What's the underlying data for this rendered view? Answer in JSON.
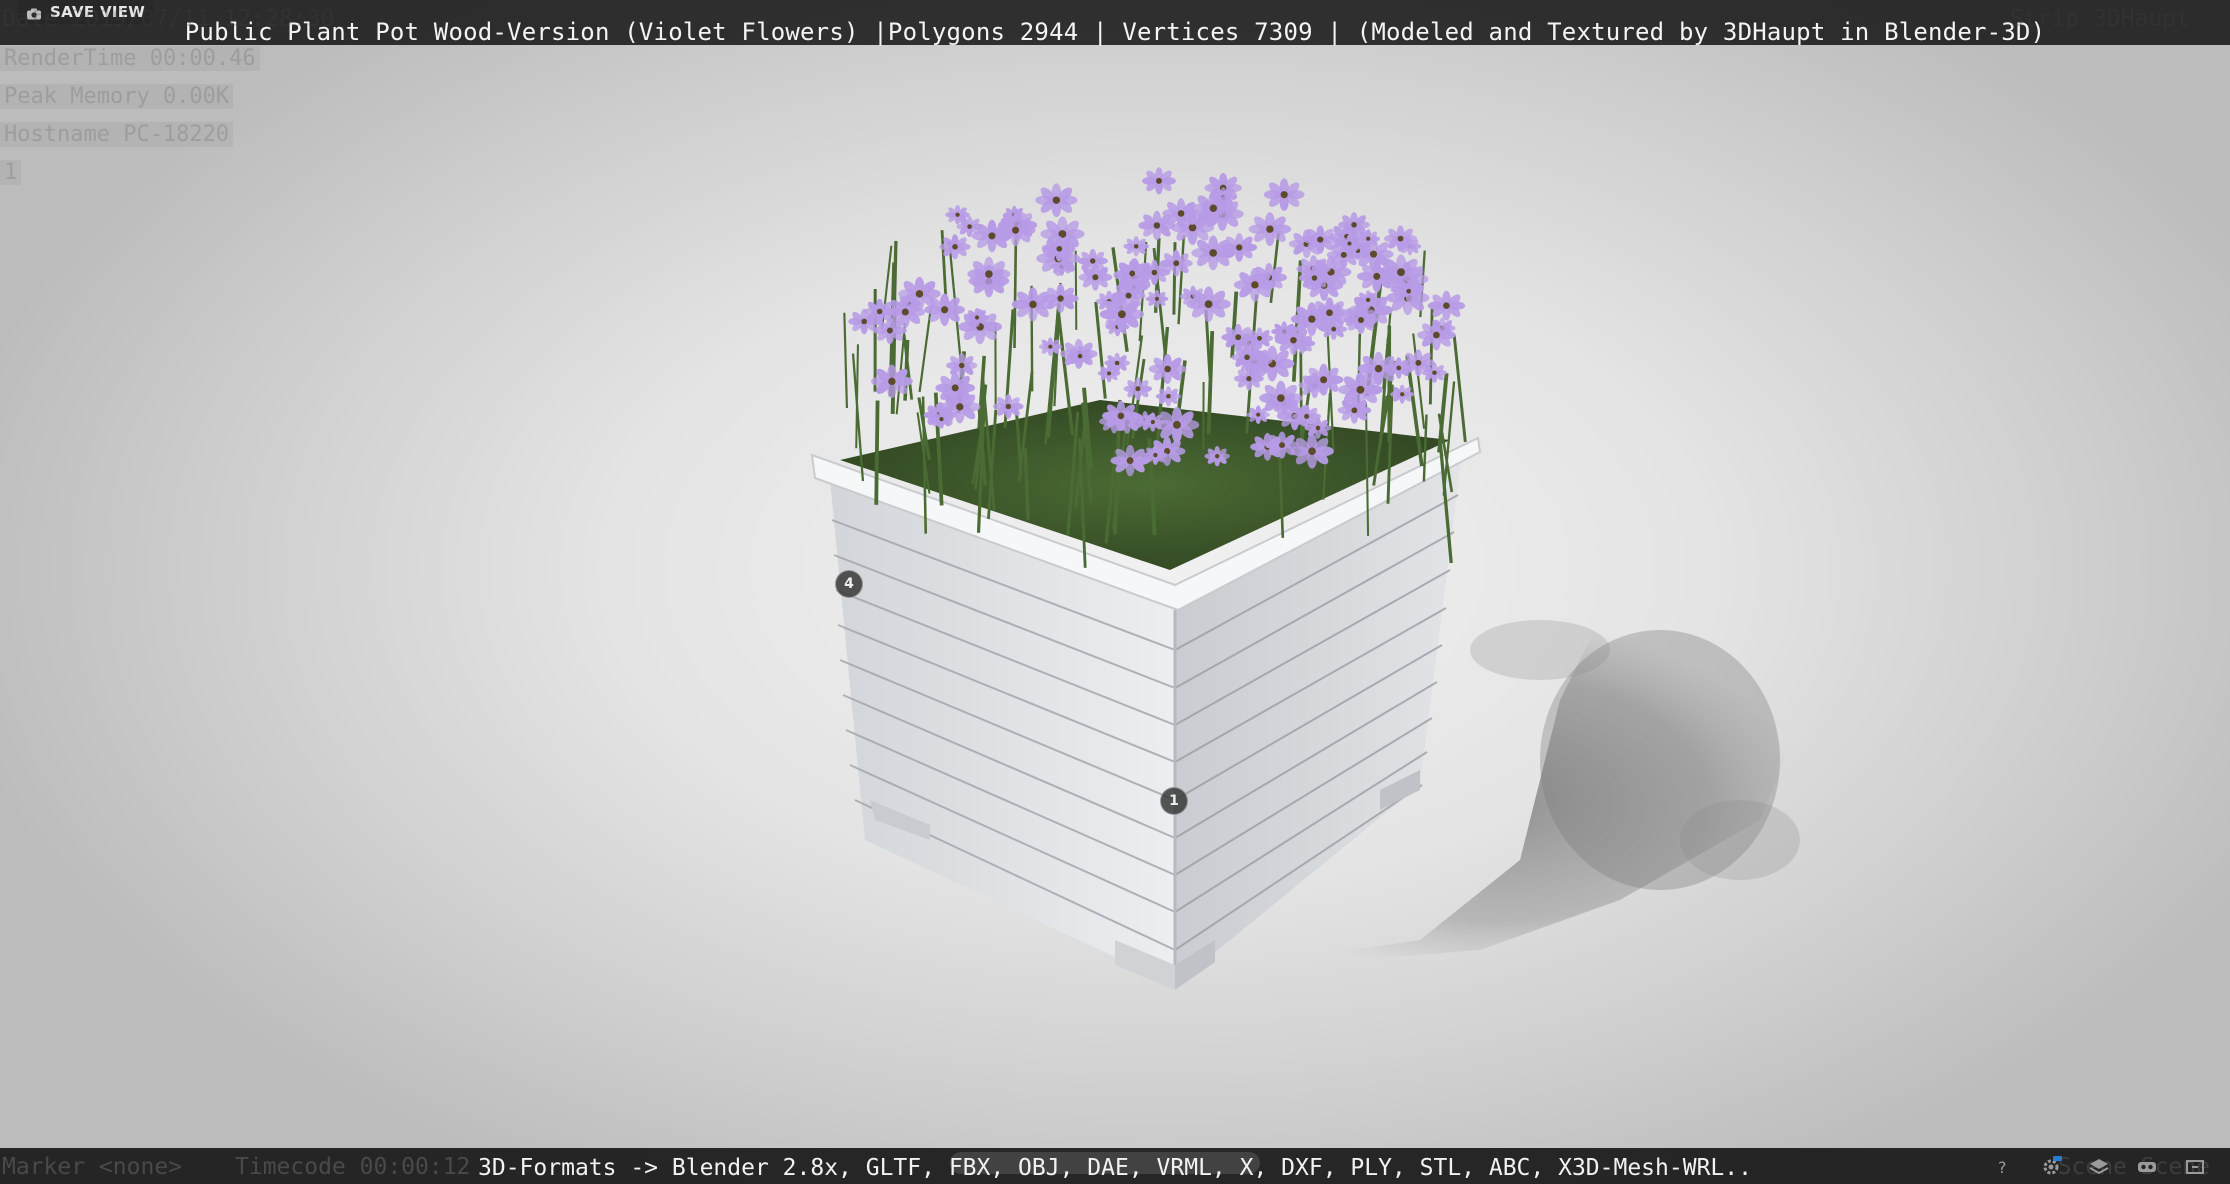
{
  "viewer": {
    "title": "Public Plant Pot Wood-Version (Violet Flowers) |Polygons 2944 | Vertices 7309 | (Modeled and Textured by 3DHaupt in Blender-3D)",
    "save_view_label": "SAVE VIEW",
    "formats_text": "3D-Formats -> Blender 2.8x, GLTF, FBX, OBJ, DAE, VRML, X, DXF, PLY, STL, ABC, X3D-Mesh-WRL..",
    "hotspots": [
      "4",
      "1"
    ]
  },
  "render_overlay": {
    "date_line": "Date 2019/07/11 12:28:30",
    "render_time": "RenderTime 00:00.46",
    "peak_memory": "Peak Memory 0.00K",
    "hostname": "Hostname PC-18220",
    "frame": "1",
    "strip": "Strip 3DHaupt",
    "marker": "Marker <none>",
    "timecode": "Timecode 00:00:12",
    "scene": "Scene Scene"
  },
  "icons": {
    "camera": "camera-icon",
    "help": "help-icon",
    "settings": "gear-icon",
    "layers": "layers-icon",
    "vr": "vr-headset-icon",
    "fullscreen": "fullscreen-icon"
  },
  "colors": {
    "flower": "#b79be6",
    "flower_center": "#5c4a2a",
    "pot_wood": "#e6e8ea",
    "foliage": "#4b6b34"
  }
}
